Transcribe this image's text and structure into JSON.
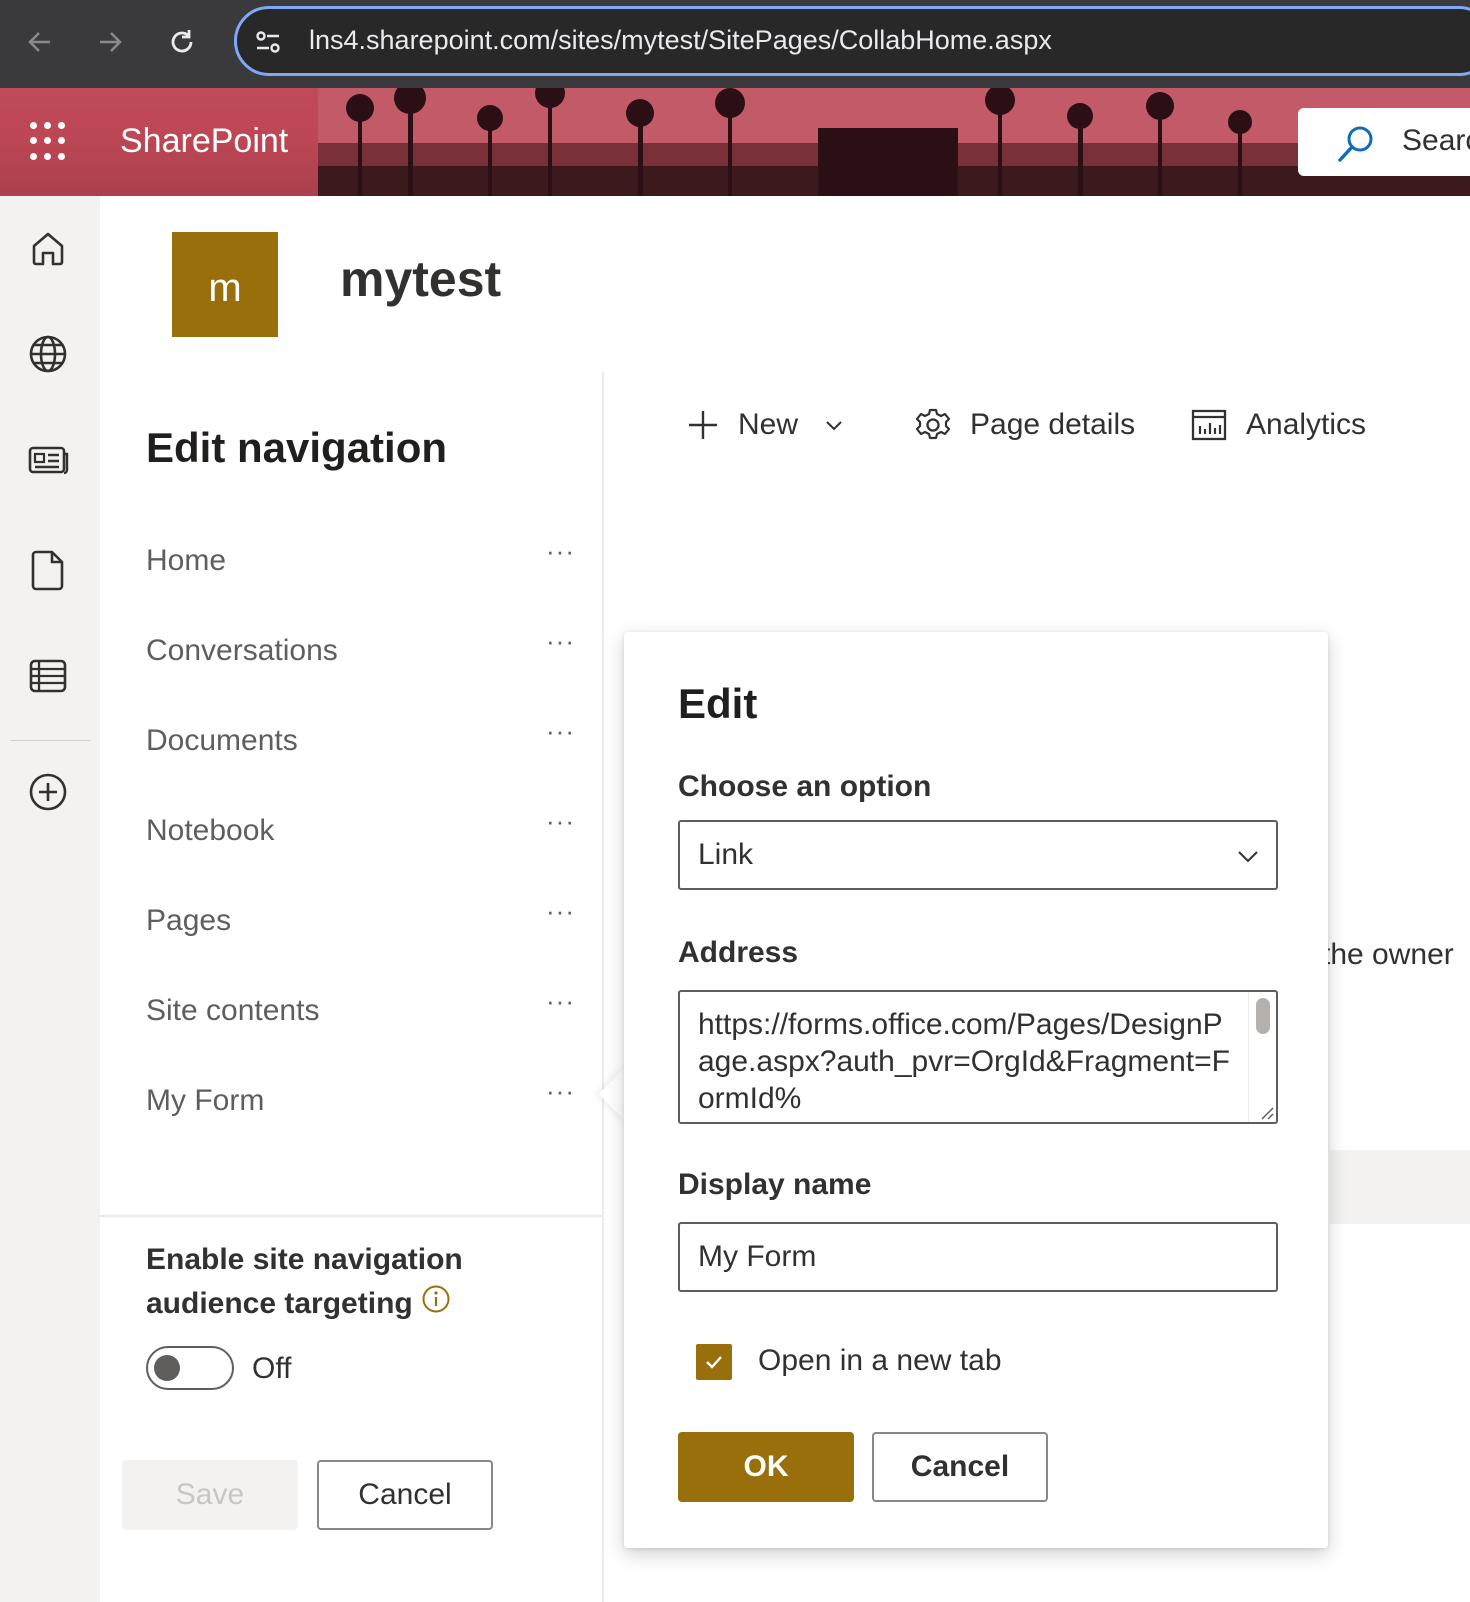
{
  "browser": {
    "url": "lns4.sharepoint.com/sites/mytest/SitePages/CollabHome.aspx"
  },
  "suite_bar": {
    "app_name": "SharePoint",
    "search_placeholder": "Searc"
  },
  "site": {
    "logo_letter": "m",
    "title": "mytest",
    "logo_color": "#986f0b"
  },
  "app_bar": {
    "icons": [
      "home-icon",
      "globe-icon",
      "news-icon",
      "document-icon",
      "list-icon",
      "add-icon"
    ]
  },
  "command_bar": {
    "new_label": "New",
    "page_details_label": "Page details",
    "analytics_label": "Analytics"
  },
  "edit_navigation": {
    "title": "Edit navigation",
    "items": [
      {
        "label": "Home",
        "more": "···"
      },
      {
        "label": "Conversations",
        "more": "···"
      },
      {
        "label": "Documents",
        "more": "···"
      },
      {
        "label": "Notebook",
        "more": "···"
      },
      {
        "label": "Pages",
        "more": "···"
      },
      {
        "label": "Site contents",
        "more": "···"
      },
      {
        "label": "My Form",
        "more": "···"
      }
    ],
    "audience_targeting_label": "Enable site navigation audience targeting",
    "toggle_state": "Off",
    "save_label": "Save",
    "cancel_label": "Cancel"
  },
  "background": {
    "partial_text": "the owner"
  },
  "edit_dialog": {
    "title": "Edit",
    "option_label": "Choose an option",
    "option_value": "Link",
    "address_label": "Address",
    "address_value": "https://forms.office.com/Pages/DesignPage.aspx?auth_pvr=OrgId&Fragment=FormId%",
    "display_name_label": "Display name",
    "display_name_value": "My Form",
    "open_new_tab_label": "Open in a new tab",
    "open_new_tab_checked": true,
    "ok_label": "OK",
    "cancel_label": "Cancel"
  }
}
